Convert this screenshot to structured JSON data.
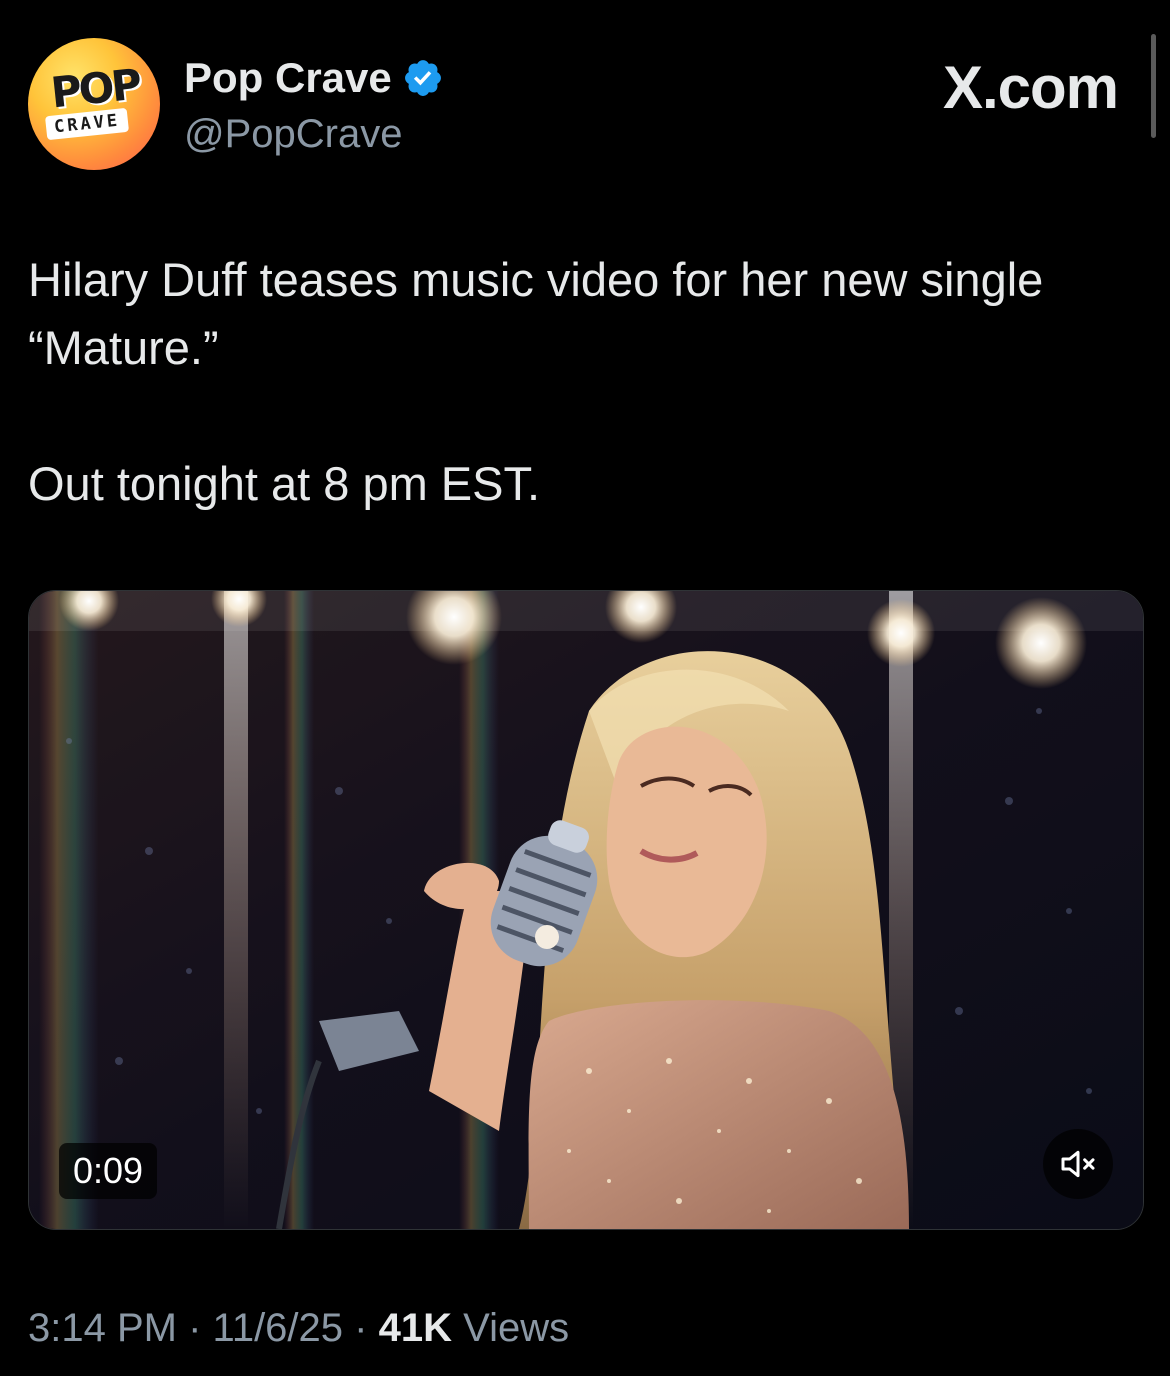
{
  "account": {
    "display_name": "Pop Crave",
    "handle": "@PopCrave",
    "verified": true,
    "avatar": {
      "line1": "POP",
      "line2": "CRAVE"
    }
  },
  "brand": {
    "label": "X.com"
  },
  "tweet": {
    "paragraphs": [
      "Hilary Duff teases music video for her new single “Mature.”",
      "Out tonight at 8 pm EST."
    ]
  },
  "media": {
    "type": "video",
    "elapsed": "0:09",
    "muted": true,
    "mute_icon": "speaker-muted-icon"
  },
  "meta": {
    "time": "3:14 PM",
    "separator": "·",
    "date": "11/6/25",
    "views_count": "41K",
    "views_label": "Views"
  },
  "colors": {
    "background": "#000000",
    "text_primary": "#e7e9ea",
    "text_secondary": "#8b98a5",
    "verified_blue": "#1d9bf0"
  }
}
